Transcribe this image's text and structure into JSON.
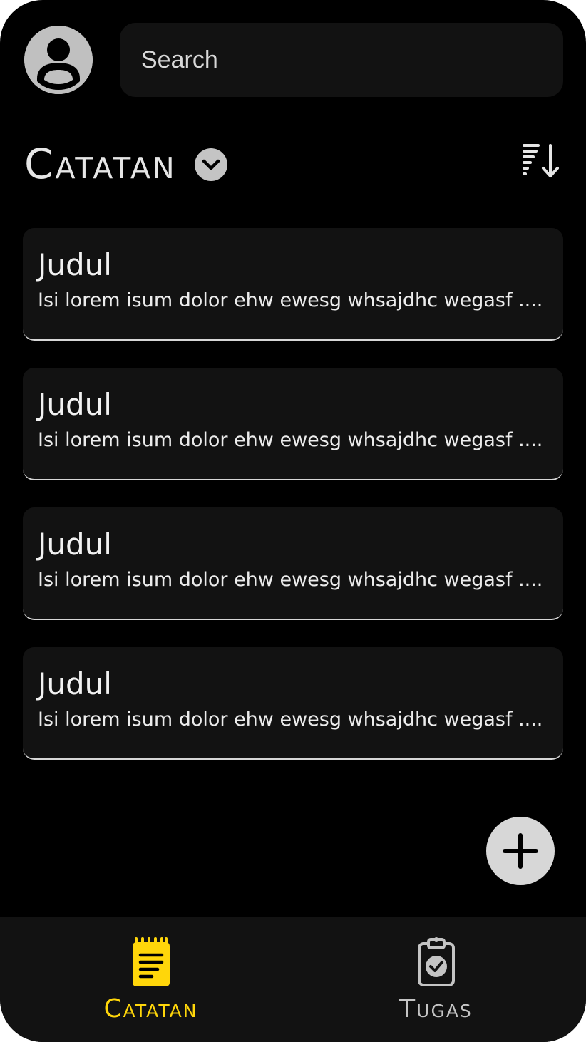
{
  "colors": {
    "background": "#000000",
    "surface": "#121212",
    "accent": "#ffd60a",
    "muted": "#c4c4c4"
  },
  "header": {
    "avatar_icon": "user-avatar-icon",
    "search_placeholder": "Search"
  },
  "section": {
    "title": "Catatan",
    "dropdown_icon": "chevron-down-icon",
    "sort_icon": "sort-descending-icon"
  },
  "notes": [
    {
      "title": "Judul",
      "body": "Isi lorem isum dolor ehw ewesg whsajdhc wegasf ...."
    },
    {
      "title": "Judul",
      "body": "Isi lorem isum dolor ehw ewesg whsajdhc wegasf ...."
    },
    {
      "title": "Judul",
      "body": "Isi lorem isum dolor ehw ewesg whsajdhc wegasf ...."
    },
    {
      "title": "Judul",
      "body": "Isi lorem isum dolor ehw ewesg whsajdhc wegasf ...."
    }
  ],
  "fab": {
    "icon": "plus-icon"
  },
  "bottom_nav": {
    "items": [
      {
        "label": "Catatan",
        "icon": "notepad-icon",
        "active": true
      },
      {
        "label": "Tugas",
        "icon": "clipboard-check-icon",
        "active": false
      }
    ]
  }
}
